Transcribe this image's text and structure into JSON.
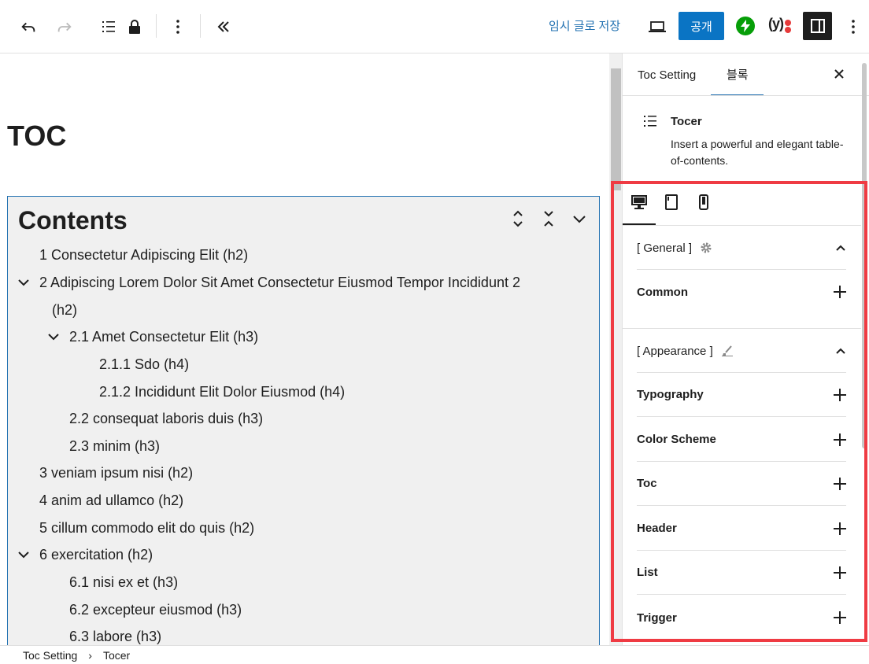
{
  "toolbar": {
    "save_draft": "임시 글로 저장",
    "publish": "공개",
    "yoast_letter": "y"
  },
  "page": {
    "title": "TOC"
  },
  "toc": {
    "heading": "Contents",
    "items": [
      "1 Consectetur Adipiscing Elit (h2)",
      "2 Adipiscing Lorem Dolor Sit Amet Consectetur Eiusmod Tempor Incididunt 2",
      "(h2)",
      "2.1 Amet Consectetur Elit (h3)",
      "2.1.1 Sdo (h4)",
      "2.1.2 Incididunt Elit Dolor Eiusmod (h4)",
      "2.2 consequat laboris duis (h3)",
      "2.3 minim (h3)",
      "3 veniam ipsum nisi (h2)",
      "4 anim ad ullamco (h2)",
      "5 cillum commodo elit do quis (h2)",
      "6 exercitation (h2)",
      "6.1 nisi ex et (h3)",
      "6.2 excepteur eiusmod (h3)",
      "6.3 labore (h3)"
    ]
  },
  "sidebar": {
    "tabs": [
      "Toc Setting",
      "블록"
    ],
    "block": {
      "name": "Tocer",
      "description": "Insert a powerful and elegant table-of-contents."
    },
    "groups": {
      "general": "[ General ]",
      "appearance": "[ Appearance ]"
    },
    "panels": [
      "Common",
      "Typography",
      "Color Scheme",
      "Toc",
      "Header",
      "List",
      "Trigger"
    ]
  },
  "breadcrumb": {
    "items": [
      "Toc Setting",
      "Tocer"
    ],
    "separator": "›"
  },
  "colors": {
    "accent": "#2271b1",
    "publish": "#0a74c4",
    "highlight_frame": "#ef3b43",
    "jetpack": "#069e08"
  }
}
